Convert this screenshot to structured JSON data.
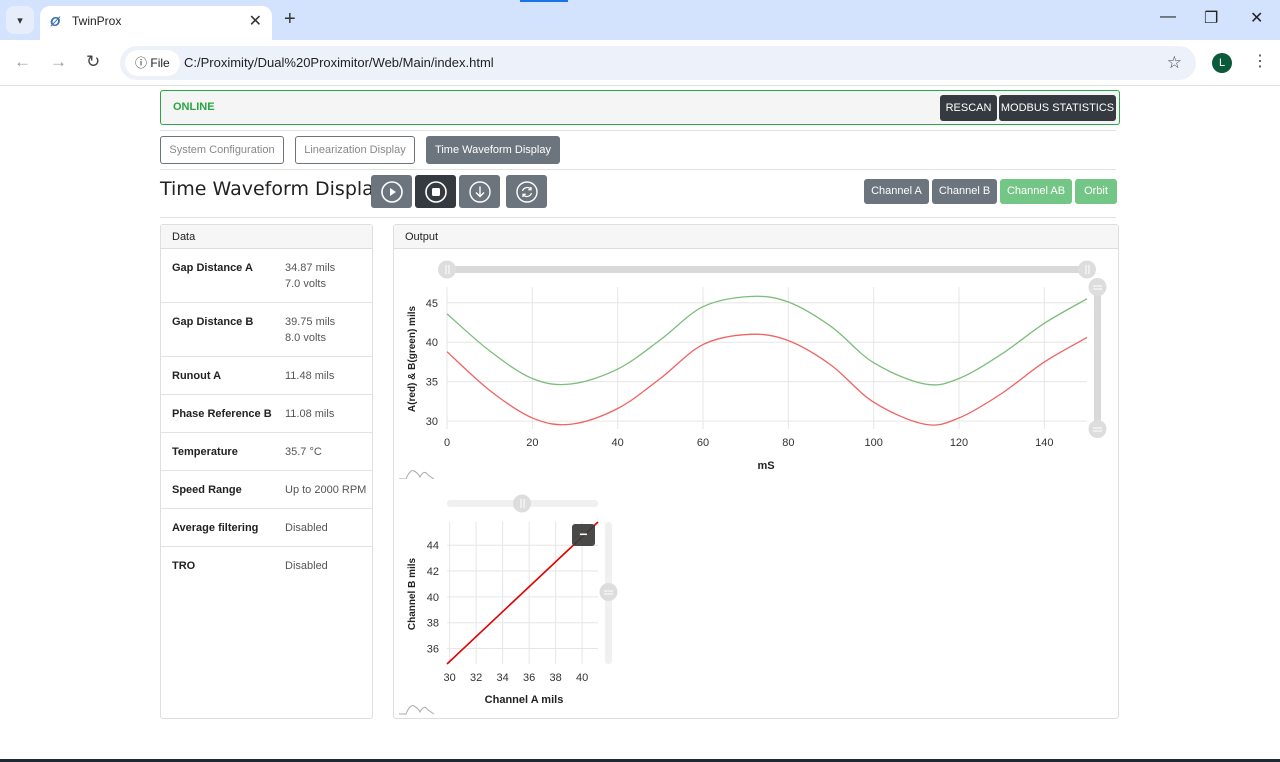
{
  "browser": {
    "tab_title": "TwinProx",
    "file_chip": "File",
    "url": "C:/Proximity/Dual%20Proximitor/Web/Main/index.html",
    "avatar_letter": "L",
    "icons": {
      "tab_menu": "▾",
      "favicon": "Ø",
      "tab_close": "✕",
      "new_tab": "+",
      "back": "←",
      "forward": "→",
      "reload": "↻",
      "info": "ⓘ",
      "star": "☆",
      "kebab": "⋮",
      "minimize": "—",
      "restore": "❐",
      "close": "✕"
    }
  },
  "status": {
    "text": "ONLINE",
    "color": "#28a745",
    "rescan_label": "RESCAN",
    "modbus_label": "MODBUS STATISTICS"
  },
  "nav_tabs": [
    {
      "label": "System Configuration",
      "active": false
    },
    {
      "label": "Linearization Display",
      "active": false
    },
    {
      "label": "Time Waveform Display",
      "active": true
    }
  ],
  "page_title": "Time Waveform Display",
  "controls": [
    {
      "name": "play",
      "active": false
    },
    {
      "name": "stop",
      "active": true
    },
    {
      "name": "download",
      "active": false
    },
    {
      "name": "refresh",
      "active": false
    }
  ],
  "channel_buttons": [
    {
      "label": "Channel A",
      "style": "gray"
    },
    {
      "label": "Channel B",
      "style": "gray"
    },
    {
      "label": "Channel AB",
      "style": "green"
    },
    {
      "label": "Orbit",
      "style": "green"
    }
  ],
  "data_panel": {
    "header": "Data",
    "rows": [
      {
        "label": "Gap Distance A",
        "value": "34.87 mils",
        "value2": "7.0 volts"
      },
      {
        "label": "Gap Distance B",
        "value": "39.75 mils",
        "value2": "8.0 volts"
      },
      {
        "label": "Runout A",
        "value": "11.48 mils"
      },
      {
        "label": "Phase Reference B",
        "value": "11.08 mils"
      },
      {
        "label": "Temperature",
        "value": "35.7 °C"
      },
      {
        "label": "Speed Range",
        "value": "Up to 2000 RPM"
      },
      {
        "label": "Average filtering",
        "value": "Disabled"
      },
      {
        "label": "TRO",
        "value": "Disabled"
      }
    ]
  },
  "output_panel": {
    "header": "Output",
    "collapse_label": "−"
  },
  "chart_data": [
    {
      "type": "line",
      "title": "",
      "xlabel": "mS",
      "ylabel": "A(red) & B(green) mils",
      "xlim": [
        0,
        150
      ],
      "ylim": [
        29,
        47
      ],
      "xticks": [
        0,
        20,
        40,
        60,
        80,
        100,
        120,
        140
      ],
      "yticks": [
        30,
        35,
        40,
        45
      ],
      "grid": true,
      "x": [
        0,
        10,
        20,
        29,
        40,
        50,
        60,
        71,
        80,
        90,
        100,
        112,
        120,
        130,
        140,
        150
      ],
      "series": [
        {
          "name": "A",
          "color": "#f06262",
          "values": [
            38.8,
            33.9,
            30.4,
            29.6,
            31.6,
            35.4,
            39.7,
            41.0,
            40.2,
            37.1,
            32.4,
            29.6,
            30.4,
            33.5,
            37.5,
            40.6
          ]
        },
        {
          "name": "B",
          "color": "#7cbd7c",
          "values": [
            43.6,
            38.9,
            35.4,
            34.7,
            36.6,
            40.3,
            44.5,
            45.8,
            45.1,
            42.0,
            37.4,
            34.7,
            35.4,
            38.5,
            42.4,
            45.5
          ]
        }
      ]
    },
    {
      "type": "scatter",
      "title": "",
      "xlabel": "Channel A mils",
      "ylabel": "Channel B mils",
      "xlim": [
        29.8,
        41.2
      ],
      "ylim": [
        34.8,
        45.8
      ],
      "xticks": [
        30,
        32,
        34,
        36,
        38,
        40
      ],
      "yticks": [
        36,
        38,
        40,
        42,
        44
      ],
      "grid": true,
      "series": [
        {
          "name": "AB",
          "color": "#e00000",
          "points": [
            [
              29.8,
              34.8
            ],
            [
              41.2,
              45.8
            ]
          ]
        }
      ]
    }
  ]
}
